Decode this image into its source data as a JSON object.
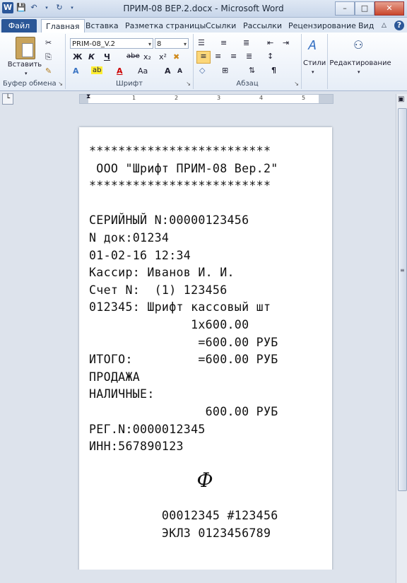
{
  "window": {
    "title": "ПРИМ-08 ВЕР.2.docx - Microsoft Word",
    "logo": "W"
  },
  "ribbon_tabs": [
    "Файл",
    "Главная",
    "Вставка",
    "Разметка страницы",
    "Ссылки",
    "Рассылки",
    "Рецензирование",
    "Вид"
  ],
  "ribbon": {
    "paste_label": "Вставить",
    "clipboard_label": "Буфер обмена",
    "font_label": "Шрифт",
    "paragraph_label": "Абзац",
    "styles_label": "Стили",
    "editing_label": "Редактирование",
    "font_name": "PRIM-08_V.2",
    "font_size": "8",
    "bold": "Ж",
    "italic": "К",
    "underline": "Ч",
    "strike": "abe",
    "subscript": "x₂",
    "superscript": "x²",
    "case": "Aa",
    "grow": "A",
    "shrink": "A",
    "pilcrow": "¶"
  },
  "ruler": {
    "numbers": [
      "1",
      "2",
      "3",
      "4",
      "5"
    ]
  },
  "receipt": {
    "lines": [
      "*************************",
      " ООО \"Шрифт ПРИМ-08 Вер.2\"",
      "*************************",
      "",
      "СЕРИЙНЫЙ N:00000123456",
      "N док:01234",
      "01-02-16 12:34",
      "Кассир: Иванов И. И.",
      "Счет N:  (1) 123456",
      "012345: Шрифт кассовый шт",
      "              1x600.00",
      "               =600.00 РУБ",
      "ИТОГО:         =600.00 РУБ",
      "ПРОДАЖА",
      "НАЛИЧНЫЕ:",
      "                600.00 РУБ",
      "РЕГ.N:0000012345",
      "ИНН:567890123",
      "",
      "",
      "",
      "          00012345 #123456",
      "          ЭКЛЗ 0123456789"
    ],
    "fiscal_mark": "Ф"
  },
  "colors": {
    "file_tab": "#2b5797",
    "highlight": "#fbd77a"
  }
}
